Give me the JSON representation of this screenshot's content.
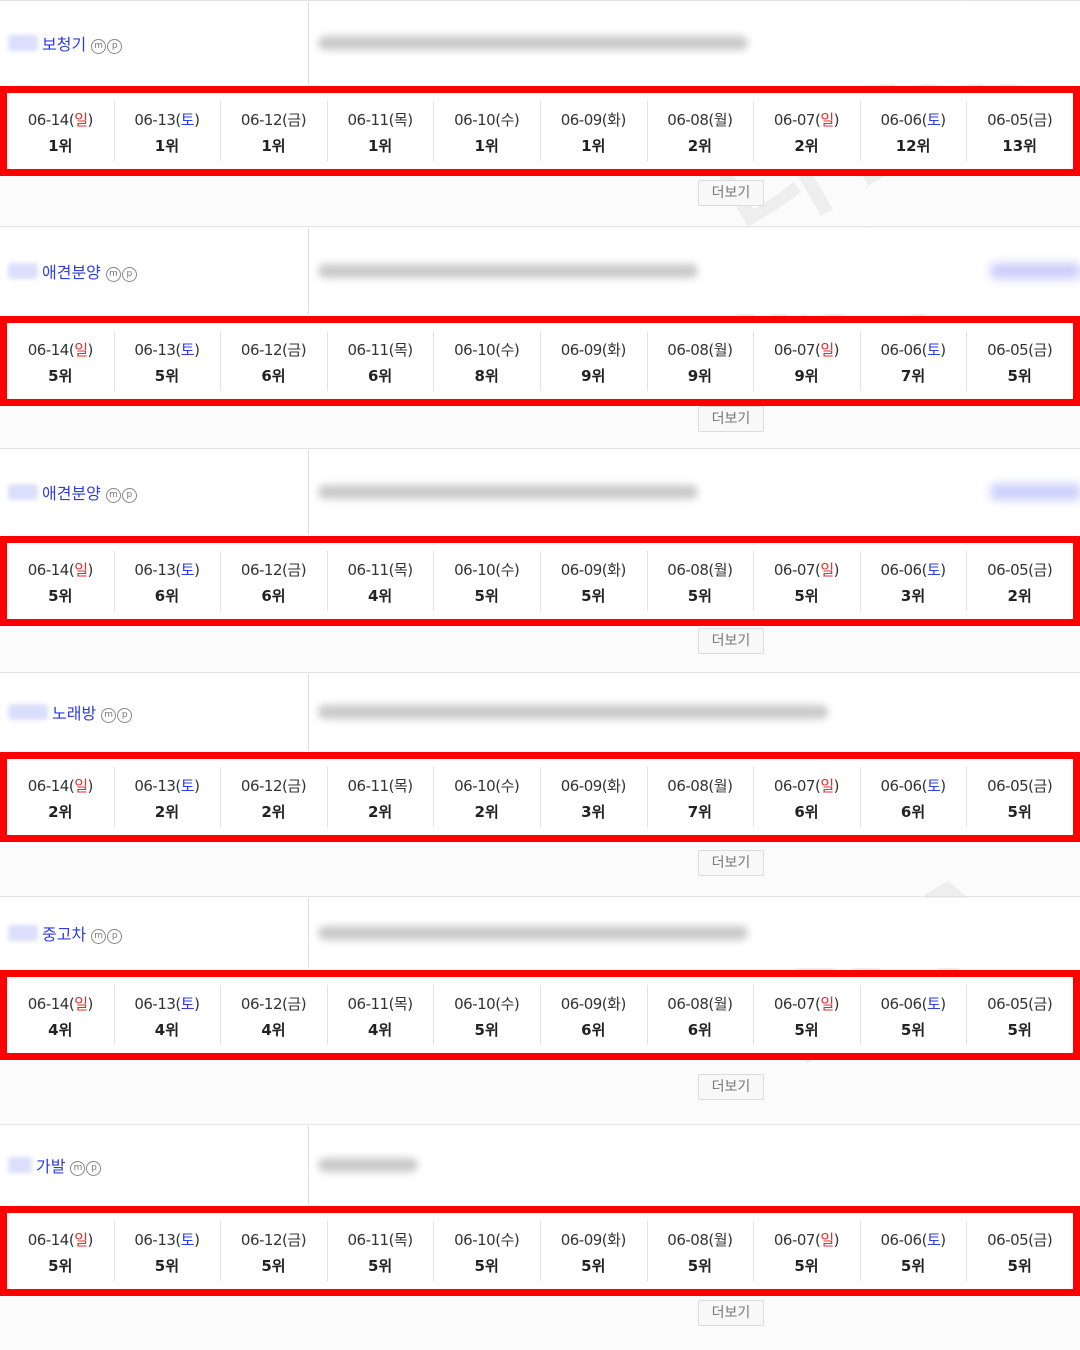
{
  "ui": {
    "more_label": "더보기",
    "m_badge": "m",
    "p_badge": "p",
    "watermark_top": "다인마",
    "watermark_mid": "다인",
    "watermark_low": "PLA"
  },
  "dates": [
    {
      "date": "06-14(",
      "day": "일",
      "close": ")",
      "type": "sun"
    },
    {
      "date": "06-13(",
      "day": "토",
      "close": ")",
      "type": "sat"
    },
    {
      "date": "06-12(",
      "day": "금",
      "close": ")",
      "type": "wk"
    },
    {
      "date": "06-11(",
      "day": "목",
      "close": ")",
      "type": "wk"
    },
    {
      "date": "06-10(",
      "day": "수",
      "close": ")",
      "type": "wk"
    },
    {
      "date": "06-09(",
      "day": "화",
      "close": ")",
      "type": "wk"
    },
    {
      "date": "06-08(",
      "day": "월",
      "close": ")",
      "type": "wk"
    },
    {
      "date": "06-07(",
      "day": "일",
      "close": ")",
      "type": "sun"
    },
    {
      "date": "06-06(",
      "day": "토",
      "close": ")",
      "type": "sat"
    },
    {
      "date": "06-05(",
      "day": "금",
      "close": ")",
      "type": "wk"
    }
  ],
  "sections": [
    {
      "keyword": "보청기",
      "ranks": [
        "1위",
        "1위",
        "1위",
        "1위",
        "1위",
        "1위",
        "2위",
        "2위",
        "12위",
        "13위"
      ]
    },
    {
      "keyword": "애견분양",
      "ranks": [
        "5위",
        "5위",
        "6위",
        "6위",
        "8위",
        "9위",
        "9위",
        "9위",
        "7위",
        "5위"
      ]
    },
    {
      "keyword": "애견분양",
      "ranks": [
        "5위",
        "6위",
        "6위",
        "4위",
        "5위",
        "5위",
        "5위",
        "5위",
        "3위",
        "2위"
      ]
    },
    {
      "keyword": "노래방",
      "ranks": [
        "2위",
        "2위",
        "2위",
        "2위",
        "2위",
        "3위",
        "7위",
        "6위",
        "6위",
        "5위"
      ]
    },
    {
      "keyword": "중고차",
      "ranks": [
        "4위",
        "4위",
        "4위",
        "4위",
        "5위",
        "6위",
        "6위",
        "5위",
        "5위",
        "5위"
      ]
    },
    {
      "keyword": "가발",
      "ranks": [
        "5위",
        "5위",
        "5위",
        "5위",
        "5위",
        "5위",
        "5위",
        "5위",
        "5위",
        "5위"
      ]
    }
  ]
}
